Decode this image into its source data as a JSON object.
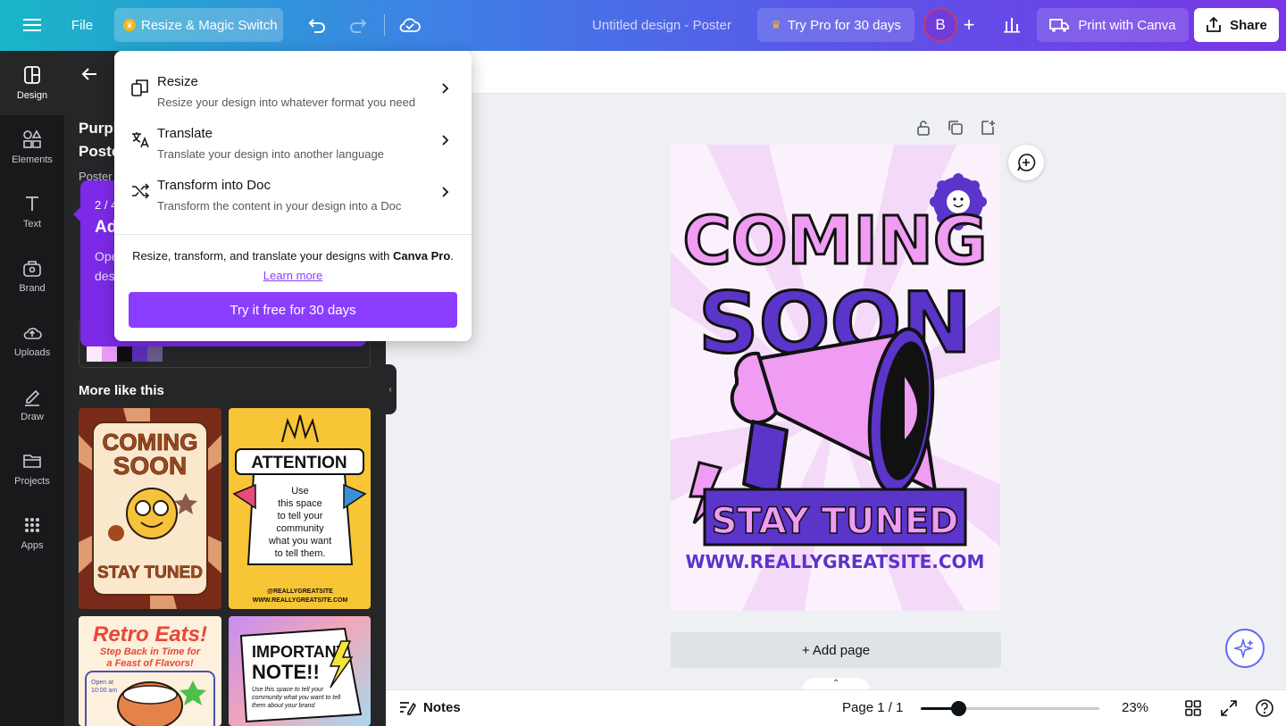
{
  "topbar": {
    "file_label": "File",
    "magic_label": "Resize & Magic Switch",
    "doc_title": "Untitled design - Poster",
    "try_pro_label": "Try Pro for 30 days",
    "avatar_initial": "B",
    "print_label": "Print with Canva",
    "share_label": "Share"
  },
  "rail": {
    "items": [
      {
        "label": "Design",
        "icon": "design-icon"
      },
      {
        "label": "Elements",
        "icon": "elements-icon"
      },
      {
        "label": "Text",
        "icon": "text-icon"
      },
      {
        "label": "Brand",
        "icon": "brand-icon"
      },
      {
        "label": "Uploads",
        "icon": "uploads-icon"
      },
      {
        "label": "Draw",
        "icon": "draw-icon"
      },
      {
        "label": "Projects",
        "icon": "projects-icon"
      },
      {
        "label": "Apps",
        "icon": "apps-icon"
      }
    ]
  },
  "panel": {
    "title": "Purple Poster",
    "subtitle": "Poster",
    "tour_step": "2 / 4",
    "tour_title": "Ad",
    "tour_text_line1": "Ope",
    "tour_text_line2": "des",
    "more_like_this": "More like this",
    "palette": [
      "#fbe9fb",
      "#e89bf0",
      "#0e0e10",
      "#5b2fb8",
      "#6a5a8a"
    ],
    "thumbnails": [
      {
        "name": "coming-soon-retro",
        "line1": "COMING",
        "line2": "SOON",
        "line3": "STAY TUNED"
      },
      {
        "name": "attention",
        "heading": "ATTENTION",
        "body": [
          "Use",
          "this space",
          "to tell your",
          "community",
          "what you want",
          "to tell them."
        ],
        "footer1": "@REALLYGREATSITE",
        "footer2": "WWW.REALLYGREATSITE.COM"
      },
      {
        "name": "retro-eats",
        "heading": "Retro Eats!",
        "sub1": "Step Back in Time for",
        "sub2": "a Feast of Flavors!",
        "open1": "Open at",
        "open2": "10:00 am"
      },
      {
        "name": "important-note",
        "heading1": "IMPORTANT",
        "heading2": "NOTE!!",
        "body": [
          "Use this space to tell your",
          "community what you want to tell",
          "them about your brand"
        ]
      }
    ]
  },
  "dropdown": {
    "items": [
      {
        "label": "Resize",
        "desc": "Resize your design into whatever format you need",
        "icon": "resize-icon"
      },
      {
        "label": "Translate",
        "desc": "Translate your design into another language",
        "icon": "translate-icon"
      },
      {
        "label": "Transform into Doc",
        "desc": "Transform the content in your design into a Doc",
        "icon": "transform-icon"
      }
    ],
    "promo_text": "Resize, transform, and translate your designs with ",
    "promo_bold": "Canva Pro",
    "promo_end": ".",
    "learn_more": "Learn more",
    "try_button": "Try it free for 30 days"
  },
  "poster": {
    "line1": "COMING",
    "line2": "SOON",
    "banner": "STAY TUNED",
    "url": "WWW.REALLYGREATSITE.COM",
    "colors": {
      "pink": "#ef9cf2",
      "purple": "#5b34c9",
      "bg": "#fbf1fd"
    }
  },
  "canvas": {
    "add_page": "+ Add page"
  },
  "bottombar": {
    "notes_label": "Notes",
    "page_indicator": "Page 1 / 1",
    "zoom_label": "23%",
    "zoom_fraction": 0.21
  }
}
